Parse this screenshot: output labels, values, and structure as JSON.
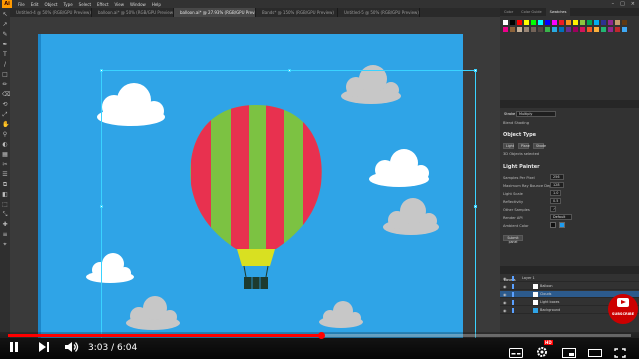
{
  "app": {
    "logo": "Ai",
    "menu": [
      "File",
      "Edit",
      "Object",
      "Type",
      "Select",
      "Effect",
      "View",
      "Window",
      "Help"
    ],
    "window_controls": [
      "–",
      "□",
      "×"
    ]
  },
  "tabs": [
    {
      "label": "Untitled-4 @ 50% (RGB/GPU Preview)",
      "active": false
    },
    {
      "label": "balloon.ai* @ 50% (RGB/GPU Preview)",
      "active": false
    },
    {
      "label": "balloon.ai* @ 27.93% (RGB/GPU Preview)",
      "active": true
    },
    {
      "label": "Bands* @ 150% (RGB/GPU Preview)",
      "active": false
    },
    {
      "label": "Untitled-5 @ 50% (RGB/GPU Preview)",
      "active": false
    }
  ],
  "tools": [
    "↖",
    "↗",
    "✎",
    "✒",
    "T",
    "/",
    "□",
    "✏",
    "⌫",
    "⟲",
    "⤢",
    "✋",
    "⚲",
    "◐",
    "▦",
    "✂",
    "☰",
    "⧉",
    "◧",
    "⬚",
    "⤡",
    "✚",
    "≡",
    "⌖"
  ],
  "colors": {
    "sky": "#2fa4e7",
    "cloud_white": "#ffffff",
    "cloud_grey": "#c7c7c7",
    "balloon_red": "#e8314f",
    "balloon_green": "#7cc242",
    "basket_yellow": "#d9e021",
    "basket_dark": "#1d3b2f",
    "selection": "#3ad3ff",
    "youtube_red": "#ff0000"
  },
  "right_panel": {
    "top_tabs": [
      "Color",
      "Color Guide",
      "Swatches"
    ],
    "swatch_colors": [
      "#ffffff",
      "#000000",
      "#ff0000",
      "#ffff00",
      "#00ff00",
      "#00ffff",
      "#0000ff",
      "#ff00ff",
      "#ed1c24",
      "#f7941d",
      "#fff200",
      "#8dc63f",
      "#00a651",
      "#00aeef",
      "#2e3192",
      "#92278f",
      "#c69c6d",
      "#603913",
      "#ec008c",
      "#8c6239",
      "#c7b299",
      "#998675",
      "#736357",
      "#534741",
      "#39b54a",
      "#29abe2",
      "#0071bc",
      "#662d91",
      "#9e005d",
      "#d4145a",
      "#f15a24",
      "#fbb03b",
      "#22b573",
      "#93278f",
      "#c1272d",
      "#3fa9f5"
    ],
    "effect_tabs": [
      "Stroke",
      "Transparency"
    ],
    "opacity_label": "Multiply",
    "effect_name": "Blend Shading",
    "object_type_title": "Object Type",
    "object_type_buttons": [
      "Light",
      "Plane",
      "Shade"
    ],
    "object_type_hint": "3D Objects selected",
    "light_painter_title": "Light Painter",
    "params": [
      {
        "label": "Samples Per Pixel",
        "value": "256"
      },
      {
        "label": "Maximum Ray Bounce Depth",
        "value": "128"
      },
      {
        "label": "Light Scale",
        "value": "1.0"
      },
      {
        "label": "Reflectivity",
        "value": "0.5"
      },
      {
        "label": "Other Samples",
        "value": "✓"
      },
      {
        "label": "Render API",
        "value": "Default"
      },
      {
        "label": "Ambient Color",
        "value": ""
      }
    ],
    "render_button": "Submit panel",
    "layers_tab": "Layers",
    "layers": [
      {
        "name": "Layer 1",
        "indent": 0
      },
      {
        "name": "Balloon",
        "indent": 1
      },
      {
        "name": "Clouds",
        "indent": 1
      },
      {
        "name": "Light boxes",
        "indent": 1
      },
      {
        "name": "Background",
        "indent": 1
      }
    ]
  },
  "player": {
    "time_current": "3:03",
    "time_total": "6:04",
    "time_separator": " / ",
    "progress_fraction": 0.503,
    "subscribe_label": "SUBSCRIBE",
    "hd_badge": "HD"
  }
}
